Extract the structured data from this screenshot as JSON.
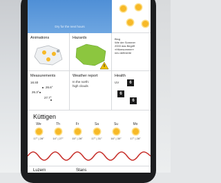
{
  "app": {
    "banner_text": "Dry for the next hours"
  },
  "tiles": {
    "animations": {
      "label": "Animations"
    },
    "hazards": {
      "label": "Hazards"
    },
    "blog": {
      "lines": [
        "Blog",
        "Wie der Sommer",
        "2003 das Begriff",
        "«Hitzesommer»",
        "neu definierte"
      ]
    },
    "measurements": {
      "label": "Measurements",
      "time": "16:40",
      "values": [
        "26.6°",
        "26.3°",
        "27.7°"
      ]
    },
    "weather_report": {
      "label": "Weather report",
      "text_lines": [
        "In the north:",
        "high clouds"
      ]
    },
    "health": {
      "label": "Health",
      "uv_label": "UV",
      "uv_values": [
        "6",
        "6",
        "6"
      ]
    }
  },
  "forecast": {
    "location": "Küttigen",
    "days": [
      {
        "name": "We",
        "temps": "17° | 28°"
      },
      {
        "name": "Th",
        "temps": "14° | 27°"
      },
      {
        "name": "Fr",
        "temps": "15° | 28°"
      },
      {
        "name": "Sa",
        "temps": "17° | 31°"
      },
      {
        "name": "Su",
        "temps": "16° | 30°"
      },
      {
        "name": "Mo",
        "temps": "17° | 28°"
      }
    ]
  },
  "bottom_tiles": [
    "Luzern",
    "Stans"
  ],
  "colors": {
    "sky": "#4f8fd6",
    "sun": "#f7b928",
    "temperature_curve": "#c8322d",
    "map_green": "#8cc63f",
    "warning": "#f2c200"
  }
}
